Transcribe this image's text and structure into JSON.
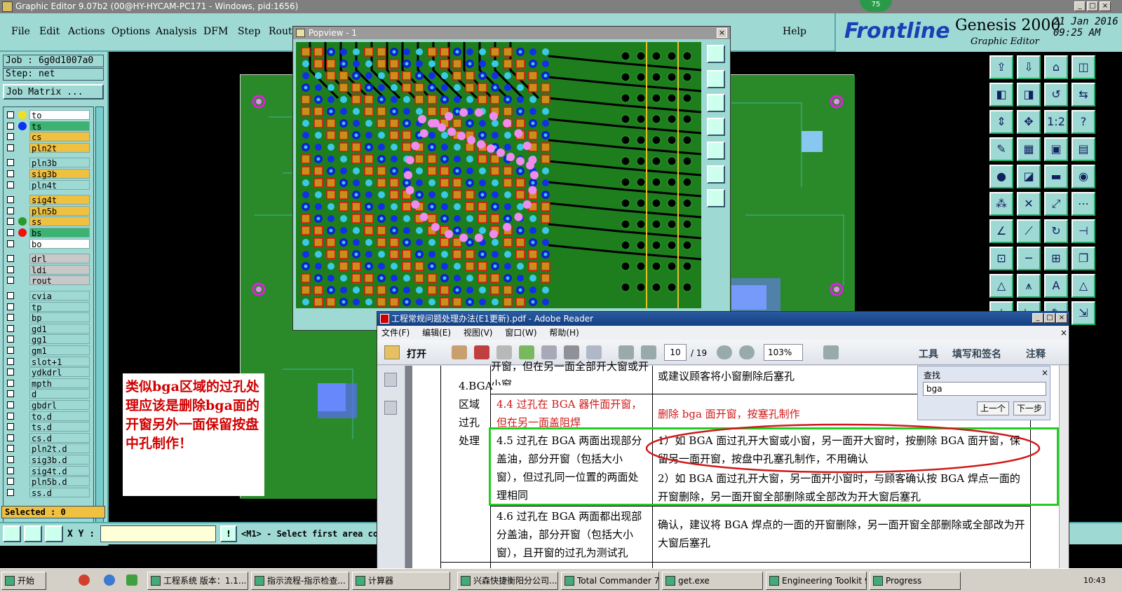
{
  "app": {
    "title": "Graphic Editor 9.07b2 (00@HY-HYCAM-PC171 - Windows, pid:1656)",
    "badge": "75"
  },
  "menu": [
    "File",
    "Edit",
    "Actions",
    "Options",
    "Analysis",
    "DFM",
    "Step",
    "Rout",
    "Help"
  ],
  "brand": {
    "logo": "Frontline",
    "product": "Genesis 2000",
    "subtitle": "Graphic Editor",
    "date": "21 Jan 2016",
    "time": "09:25 AM"
  },
  "job": {
    "job_label": "Job : 6g0d1007a0",
    "step_label": "Step: net",
    "matrix_button": "Job Matrix ..."
  },
  "layers": [
    {
      "name": "to",
      "color": "#ffffff",
      "dot": "#f0e020"
    },
    {
      "name": "ts",
      "color": "#3cb371",
      "dot": "#1030f0"
    },
    {
      "name": "cs",
      "color": "#f0c040",
      "dot": ""
    },
    {
      "name": "pln2t",
      "color": "#f0c040",
      "dot": ""
    },
    {
      "name": "pln3b",
      "color": "#9fd9d4",
      "dot": ""
    },
    {
      "name": "sig3b",
      "color": "#f0c040",
      "dot": ""
    },
    {
      "name": "pln4t",
      "color": "#9fd9d4",
      "dot": ""
    },
    {
      "name": "sig4t",
      "color": "#f0c040",
      "dot": ""
    },
    {
      "name": "pln5b",
      "color": "#f0c040",
      "dot": ""
    },
    {
      "name": "ss",
      "color": "#f0c040",
      "dot": "#2a9a2a"
    },
    {
      "name": "bs",
      "color": "#3cb371",
      "dot": "#f01010"
    },
    {
      "name": "bo",
      "color": "#ffffff",
      "dot": ""
    },
    {
      "name": "drl",
      "color": "#c8c8c8",
      "dot": ""
    },
    {
      "name": "ldi",
      "color": "#c8c8c8",
      "dot": ""
    },
    {
      "name": "rout",
      "color": "#c8c8c8",
      "dot": ""
    },
    {
      "name": "cvia",
      "color": "#9fd9d4",
      "dot": ""
    },
    {
      "name": "tp",
      "color": "#9fd9d4",
      "dot": ""
    },
    {
      "name": "bp",
      "color": "#9fd9d4",
      "dot": ""
    },
    {
      "name": "gd1",
      "color": "#9fd9d4",
      "dot": ""
    },
    {
      "name": "gg1",
      "color": "#9fd9d4",
      "dot": ""
    },
    {
      "name": "gm1",
      "color": "#9fd9d4",
      "dot": ""
    },
    {
      "name": "slot+1",
      "color": "#9fd9d4",
      "dot": ""
    },
    {
      "name": "ydkdrl",
      "color": "#9fd9d4",
      "dot": ""
    },
    {
      "name": "mpth",
      "color": "#9fd9d4",
      "dot": ""
    },
    {
      "name": "d",
      "color": "#9fd9d4",
      "dot": ""
    },
    {
      "name": "gbdrl",
      "color": "#9fd9d4",
      "dot": ""
    },
    {
      "name": "to.d",
      "color": "#9fd9d4",
      "dot": ""
    },
    {
      "name": "ts.d",
      "color": "#9fd9d4",
      "dot": ""
    },
    {
      "name": "cs.d",
      "color": "#9fd9d4",
      "dot": ""
    },
    {
      "name": "pln2t.d",
      "color": "#9fd9d4",
      "dot": ""
    },
    {
      "name": "sig3b.d",
      "color": "#9fd9d4",
      "dot": ""
    },
    {
      "name": "sig4t.d",
      "color": "#9fd9d4",
      "dot": ""
    },
    {
      "name": "pln5b.d",
      "color": "#9fd9d4",
      "dot": ""
    },
    {
      "name": "ss.d",
      "color": "#9fd9d4",
      "dot": ""
    }
  ],
  "popview": {
    "title": "Popview - 1"
  },
  "annotation": "类似bga区域的过孔处理应该是删除bga面的开窗另外一面保留按盘中孔制作！",
  "status": {
    "selected": "Selected : 0",
    "xy_label": "X Y :",
    "message": "<M1> - Select first area cor"
  },
  "adobe": {
    "title": "工程常规问题处理办法(E1更新).pdf - Adobe Reader",
    "menu": [
      "文件(F)",
      "编辑(E)",
      "视图(V)",
      "窗口(W)",
      "帮助(H)"
    ],
    "open_label": "打开",
    "page_current": "10",
    "page_total": "/ 19",
    "zoom": "103%",
    "tools": "工具",
    "sign": "填写和签名",
    "comment": "注释",
    "find_title": "查找",
    "find_value": "bga",
    "find_prev": "上一个",
    "find_next": "下一步",
    "table": {
      "category": "4.BGA区域过孔处理",
      "row0_left": "开窗，但在另一面全部开大窗或开小窗",
      "row0_right": "或建议顾客将小窗删除后塞孔",
      "row1_left": "4.4  过孔在 BGA 器件面开窗，但在另一面盖阻焊",
      "row1_right": "删除 bga 面开窗，按塞孔制作",
      "row2_left": "4.5  过孔在 BGA 两面出现部分盖油，部分开窗（包括大小窗），但过孔同一位置的两面处理相同",
      "row2_right_1": "1）如 BGA 面过孔开大窗或小窗，另一面开大窗时，按删除 BGA 面开窗，保留另一面开窗，按盘中孔塞孔制作，不用确认",
      "row2_right_2": "2）如 BGA 面过孔开大窗，另一面开小窗时，与顾客确认按 BGA 焊点一面的开窗删除，另一面开窗全部删除或全部改为开大窗后塞孔",
      "row3_left": "4.6  过孔在 BGA 两面都出现部分盖油，部分开窗（包括大小窗），且开窗的过孔为测试孔",
      "row3_right": "确认，建议将 BGA 焊点的一面的开窗删除，另一面开窗全部删除或全部改为开大窗后塞孔"
    }
  },
  "taskbar": [
    {
      "label": "开始"
    },
    {
      "label": "工程系统  版本：1.1..."
    },
    {
      "label": "指示流程-指示检查..."
    },
    {
      "label": "计算器"
    },
    {
      "label": "兴森快捷衡阳分公司..."
    },
    {
      "label": "Total Commander 7.0 ..."
    },
    {
      "label": "get.exe"
    },
    {
      "label": "Engineering Toolkit 9.0..."
    },
    {
      "label": "Progress"
    }
  ],
  "clock": "10:43"
}
